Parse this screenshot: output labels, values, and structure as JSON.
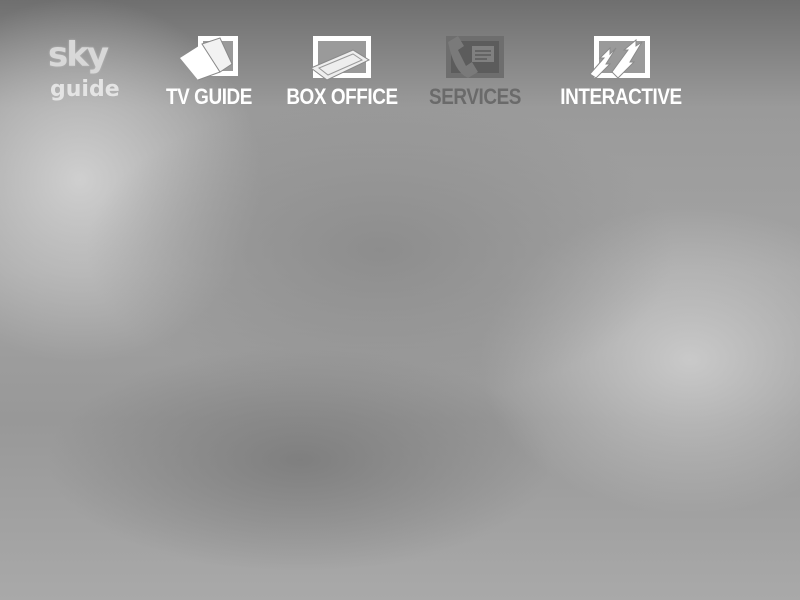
{
  "logo": {
    "line1": "sky",
    "line2": "guide"
  },
  "menu": [
    {
      "label": "TV GUIDE",
      "icon": "tv-guide-book-icon",
      "state": "normal"
    },
    {
      "label": "BOX OFFICE",
      "icon": "box-office-ticket-icon",
      "state": "normal"
    },
    {
      "label": "SERVICES",
      "icon": "services-phone-icon",
      "state": "selected"
    },
    {
      "label": "INTERACTIVE",
      "icon": "interactive-arrows-icon",
      "state": "normal"
    }
  ],
  "colors": {
    "label_normal": "#ffffff",
    "label_selected": "#6a6a6a",
    "icon_frame": "#ffffff"
  }
}
